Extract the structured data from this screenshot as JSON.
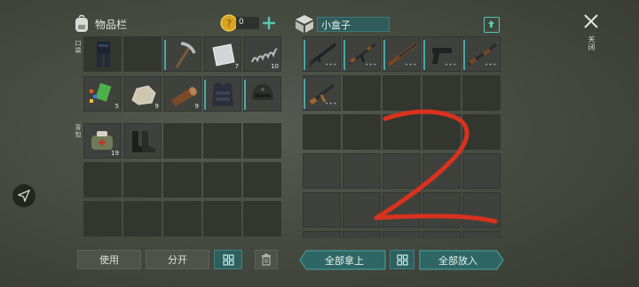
{
  "inventory": {
    "title": "物品栏",
    "coin_count": "0",
    "pocket_label": "口袋",
    "bag_label": "背包",
    "pocket_counts": [
      "",
      "",
      "",
      "7",
      "10",
      "5",
      "9",
      "9",
      "",
      ""
    ],
    "bag_counts": [
      "19",
      ""
    ]
  },
  "box": {
    "title": "小盒子"
  },
  "close_label": "关闭",
  "buttons": {
    "use": "使用",
    "split": "分开",
    "take_all": "全部拿上",
    "put_all": "全部放入"
  },
  "annotation": {
    "color": "#d8321e"
  }
}
